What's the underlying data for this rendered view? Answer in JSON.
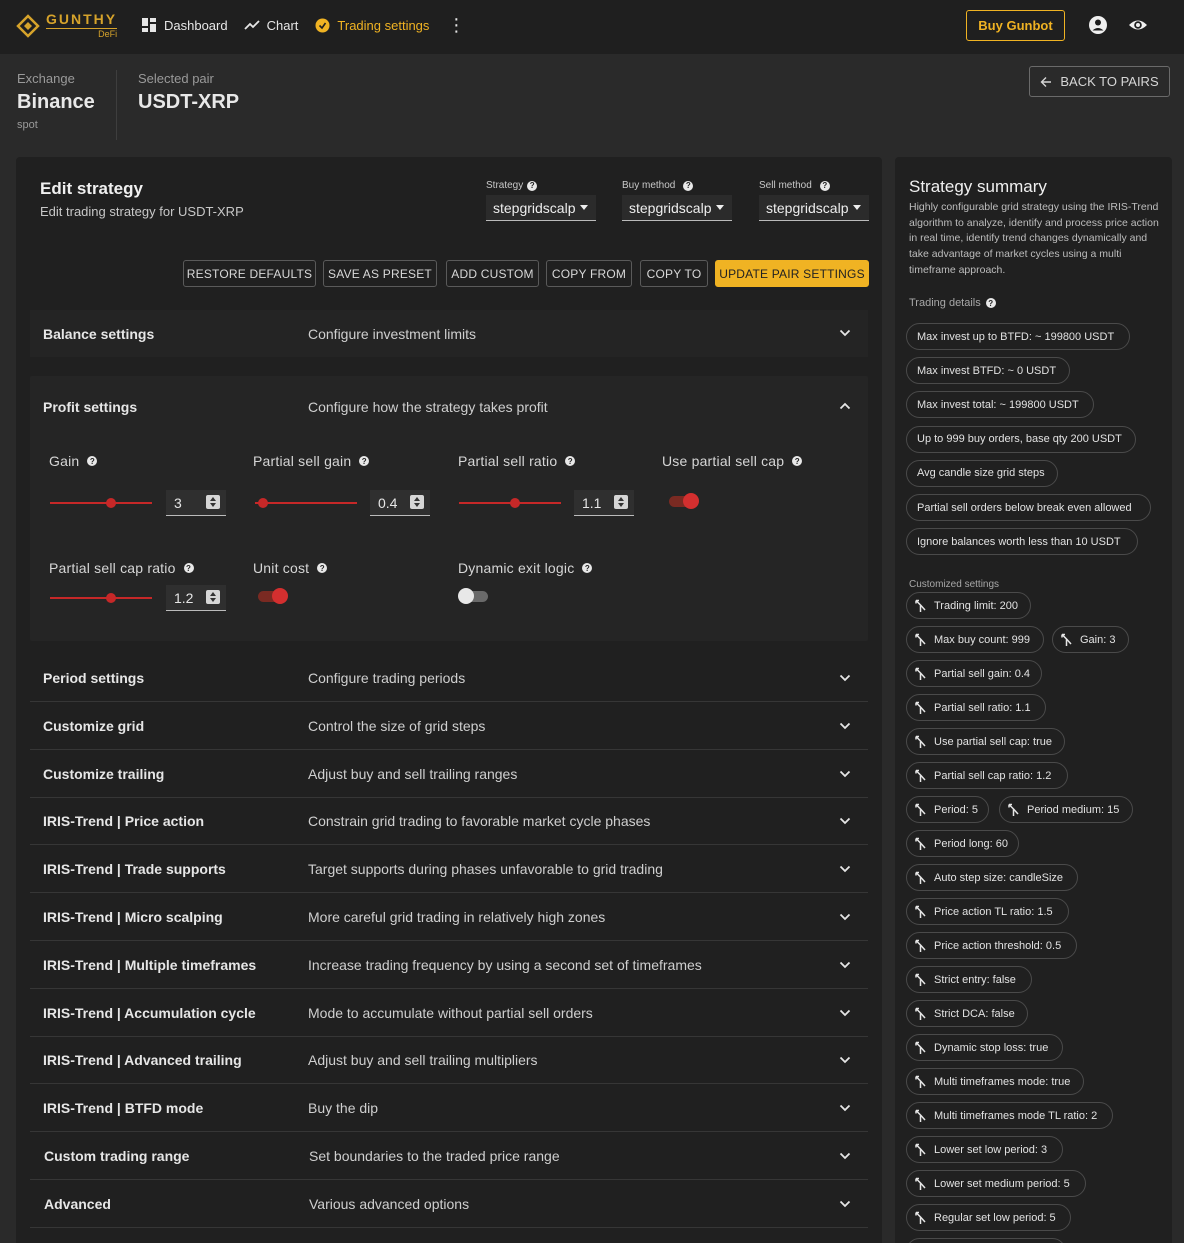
{
  "brand": {
    "name": "GUNTHY",
    "sub": "DeFi",
    "accent": "#f0b323"
  },
  "nav": [
    {
      "label": "Dashboard",
      "icon": "dashboard-icon"
    },
    {
      "label": "Chart",
      "icon": "chart-icon"
    },
    {
      "label": "Trading settings",
      "icon": "settings-icon",
      "active": true
    }
  ],
  "header": {
    "buy_label": "Buy Gunbot",
    "exchange_label": "Exchange",
    "exchange": "Binance",
    "market": "spot",
    "pair_label": "Selected pair",
    "pair": "USDT-XRP",
    "back_label": "BACK TO PAIRS"
  },
  "edit": {
    "title": "Edit strategy",
    "subtitle": "Edit trading strategy for USDT-XRP",
    "strategy_label": "Strategy",
    "strategy_value": "stepgridscalp",
    "buy_label": "Buy method",
    "buy_value": "stepgridscalp",
    "sell_label": "Sell method",
    "sell_value": "stepgridscalp",
    "buttons": {
      "restore": "RESTORE DEFAULTS",
      "save": "SAVE AS PRESET",
      "add": "ADD CUSTOM",
      "copy_from": "COPY FROM",
      "copy_to": "COPY TO",
      "update": "UPDATE PAIR SETTINGS"
    }
  },
  "sections": {
    "balance": {
      "title": "Balance settings",
      "desc": "Configure investment limits"
    },
    "profit": {
      "title": "Profit settings",
      "desc": "Configure how the strategy takes profit"
    },
    "rest": [
      {
        "title": "Period settings",
        "desc": "Configure trading periods"
      },
      {
        "title": "Customize grid",
        "desc": "Control the size of grid steps"
      },
      {
        "title": "Customize trailing",
        "desc": "Adjust buy and sell trailing ranges"
      },
      {
        "title": "IRIS-Trend | Price action",
        "desc": "Constrain grid trading to favorable market cycle phases"
      },
      {
        "title": "IRIS-Trend | Trade supports",
        "desc": "Target supports during phases unfavorable to grid trading"
      },
      {
        "title": "IRIS-Trend | Micro scalping",
        "desc": "More careful grid trading in relatively high zones"
      },
      {
        "title": "IRIS-Trend | Multiple timeframes",
        "desc": "Increase trading frequency by using a second set of timeframes"
      },
      {
        "title": "IRIS-Trend | Accumulation cycle",
        "desc": "Mode to accumulate without partial sell orders"
      },
      {
        "title": "IRIS-Trend | Advanced trailing",
        "desc": "Adjust buy and sell trailing multipliers"
      },
      {
        "title": "IRIS-Trend | BTFD mode",
        "desc": "Buy the dip"
      },
      {
        "title": "Custom trading range",
        "desc": "Set boundaries to the traded price range"
      },
      {
        "title": "Advanced",
        "desc": "Various advanced options"
      }
    ]
  },
  "profit_fields": {
    "gain": {
      "label": "Gain",
      "value": "3",
      "level": 0.6
    },
    "partial_sell_gain": {
      "label": "Partial sell gain",
      "value": "0.4",
      "level": 0.08
    },
    "partial_sell_ratio": {
      "label": "Partial sell ratio",
      "value": "1.1",
      "level": 0.55
    },
    "use_partial_sell_cap": {
      "label": "Use partial sell cap",
      "on": true
    },
    "partial_sell_cap_ratio": {
      "label": "Partial sell cap ratio",
      "value": "1.2",
      "level": 0.6
    },
    "unit_cost": {
      "label": "Unit cost",
      "on": true
    },
    "dynamic_exit_logic": {
      "label": "Dynamic exit logic",
      "on": false
    }
  },
  "summary": {
    "title": "Strategy summary",
    "desc": "Highly configurable grid strategy using the IRIS-Trend algorithm to analyze, identify and process price action in real time, identify trend changes dynamically and take advantage of market cycles using a multi timeframe approach.",
    "details_label": "Trading details",
    "details": [
      "Max invest up to BTFD: ~ 199800 USDT",
      "Max invest BTFD: ~ 0 USDT",
      "Max invest total: ~ 199800 USDT",
      "Up to 999 buy orders, base qty 200 USDT",
      "Avg candle size grid steps",
      "Partial sell orders below break even allowed",
      "Ignore balances worth less than 10 USDT"
    ],
    "custom_label": "Customized settings",
    "custom": [
      "Trading limit: 200",
      "Max buy count: 999",
      "Gain: 3",
      "Partial sell gain: 0.4",
      "Partial sell ratio: 1.1",
      "Use partial sell cap: true",
      "Partial sell cap ratio: 1.2",
      "Period: 5",
      "Period medium: 15",
      "Period long: 60",
      "Auto step size: candleSize",
      "Price action TL ratio: 1.5",
      "Price action threshold: 0.5",
      "Strict entry: false",
      "Strict DCA: false",
      "Dynamic stop loss: true",
      "Multi timeframes mode: true",
      "Multi timeframes mode TL ratio: 2",
      "Lower set low period: 3",
      "Lower set medium period: 5",
      "Regular set low period: 5"
    ]
  }
}
